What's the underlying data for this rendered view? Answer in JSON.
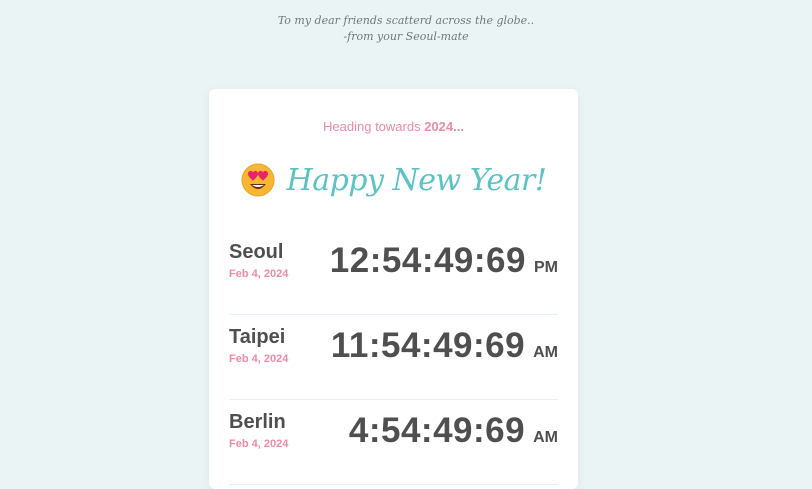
{
  "dedication": {
    "line1": "To my dear friends scatterd across the globe..",
    "line2": "-from your Seoul-mate"
  },
  "card": {
    "heading_prefix": "Heading towards ",
    "heading_year": "2024...",
    "title": "Happy New Year!",
    "emoji_icon": "heart-eyes-emoji-icon"
  },
  "cities": [
    {
      "name": "Seoul",
      "date": "Feb 4, 2024",
      "time": "12:54:49:69",
      "ampm": "PM"
    },
    {
      "name": "Taipei",
      "date": "Feb 4, 2024",
      "time": "11:54:49:69",
      "ampm": "AM"
    },
    {
      "name": "Berlin",
      "date": "Feb 4, 2024",
      "time": "4:54:49:69",
      "ampm": "AM"
    }
  ],
  "colors": {
    "background": "#eaf4f4",
    "card": "#ffffff",
    "accent_pink": "#f08aa6",
    "accent_teal": "#5cc2c4",
    "text_dark": "#4f4f4f"
  }
}
